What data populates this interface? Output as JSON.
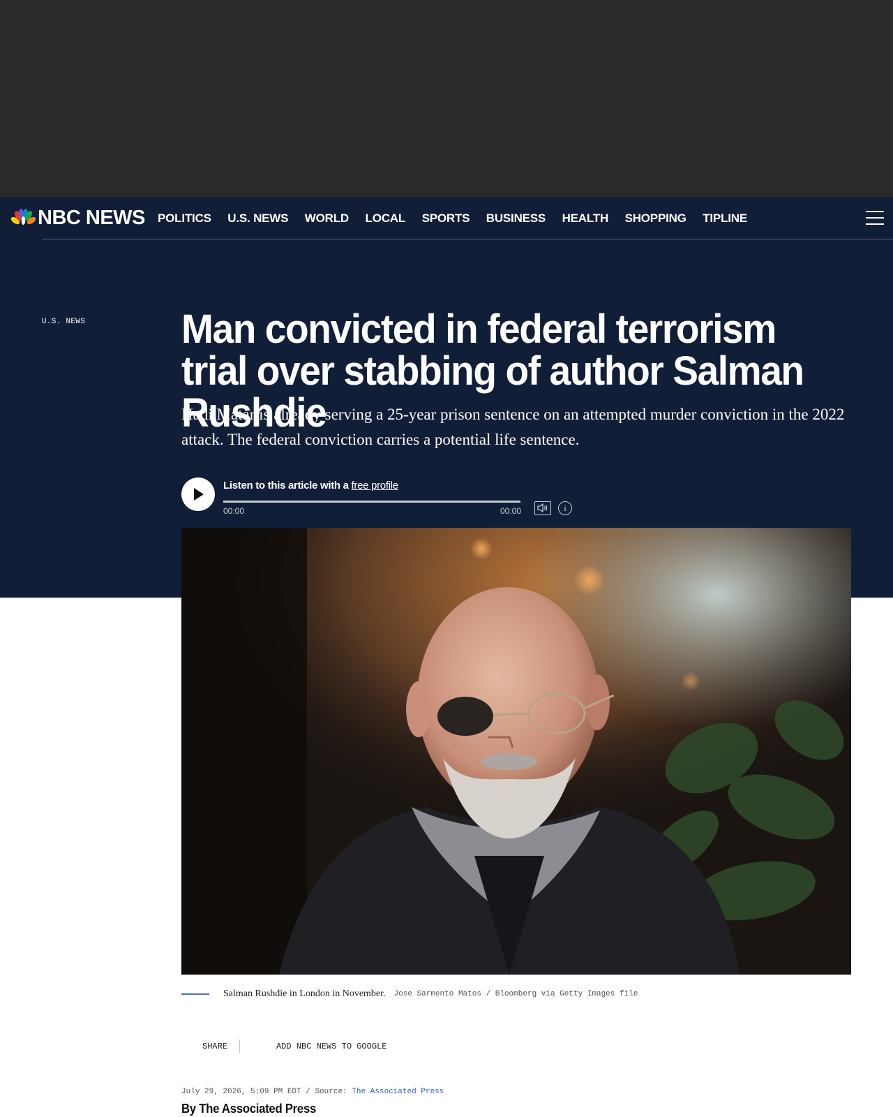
{
  "brand": {
    "name": "NBC NEWS",
    "logo_icon": "nbc-peacock-icon"
  },
  "nav": {
    "items": [
      {
        "label": "POLITICS"
      },
      {
        "label": "U.S. NEWS"
      },
      {
        "label": "WORLD"
      },
      {
        "label": "LOCAL"
      },
      {
        "label": "SPORTS"
      },
      {
        "label": "BUSINESS"
      },
      {
        "label": "HEALTH"
      },
      {
        "label": "SHOPPING"
      },
      {
        "label": "TIPLINE"
      }
    ],
    "menu_icon": "hamburger-menu-icon"
  },
  "article": {
    "section": "U.S. NEWS",
    "headline": "Man convicted in federal terrorism trial over stabbing of author Salman Rushdie",
    "dek": "Hadi Matar is already serving a 25-year prison sentence on an attempted murder conviction in the 2022 attack. The federal conviction carries a potential life sentence.",
    "audio": {
      "label_prefix": "Listen to this article with a ",
      "link_text": "free profile",
      "time_current": "00:00",
      "time_total": "00:00",
      "progress": 0,
      "icons": [
        "play-icon",
        "volume-icon",
        "info-icon"
      ]
    },
    "image": {
      "caption": "Salman Rushdie in London in November.",
      "credit": "Jose Sarmento Matos / Bloomberg via Getty Images file"
    },
    "share": {
      "share_label": "SHARE",
      "google_label": "ADD NBC NEWS TO GOOGLE"
    },
    "meta": {
      "date": "July 29, 2026, 5:09 PM EDT",
      "separator": " / ",
      "source_label": "Source: ",
      "source_name": "The Associated Press"
    },
    "byline": "By The Associated Press"
  },
  "colors": {
    "nav_bg": "#111e38",
    "ad_bg": "#2a2a2a",
    "link": "#3061c4",
    "caption_rule": "#4a6fbf"
  }
}
